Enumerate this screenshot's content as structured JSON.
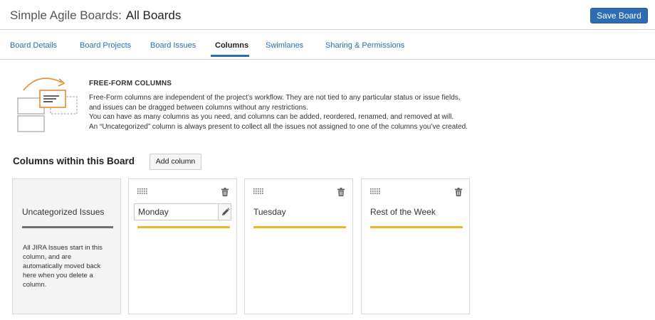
{
  "header": {
    "app_title": "Simple Agile Boards:",
    "page_title": "All Boards",
    "save_label": "Save Board"
  },
  "tabs": [
    {
      "label": "Board Details",
      "active": false
    },
    {
      "label": "Board Projects",
      "active": false
    },
    {
      "label": "Board Issues",
      "active": false
    },
    {
      "label": "Columns",
      "active": true
    },
    {
      "label": "Swimlanes",
      "active": false
    },
    {
      "label": "Sharing & Permissions",
      "active": false
    }
  ],
  "intro": {
    "heading": "FREE-FORM COLUMNS",
    "lines": [
      "Free-Form columns are independent of the project’s workflow. They are not tied to any particular status or issue fields,",
      "and issues can be dragged between columns without any restrictions.",
      "You can have as many columns as you need, and columns can be added, reordered, renamed, and removed at will.",
      "An “Uncategorized” column is always present to collect all the issues not assigned to one of the columns you’ve created."
    ],
    "illustration_icon": "columns-illustration-icon"
  },
  "section": {
    "title": "Columns within this Board",
    "add_column_label": "Add column"
  },
  "uncategorized": {
    "title": "Uncategorized Issues",
    "description": "All JIRA Issues start in this column, and are automatically moved back here when you delete a column."
  },
  "columns": [
    {
      "name": "Monday",
      "editing": true
    },
    {
      "name": "Tuesday",
      "editing": false
    },
    {
      "name": "Rest of the Week",
      "editing": false
    }
  ],
  "colors": {
    "primary": "#2d6db5",
    "tab_link": "#2a6db5",
    "column_bar": "#f0b623",
    "uncategorized_bar": "#707070",
    "uncategorized_bg": "#f4f4f4",
    "illustration_accent": "#e98a2c"
  },
  "icons": {
    "drag": "drag-handle-icon",
    "delete": "trash-icon",
    "edit": "pencil-icon"
  }
}
